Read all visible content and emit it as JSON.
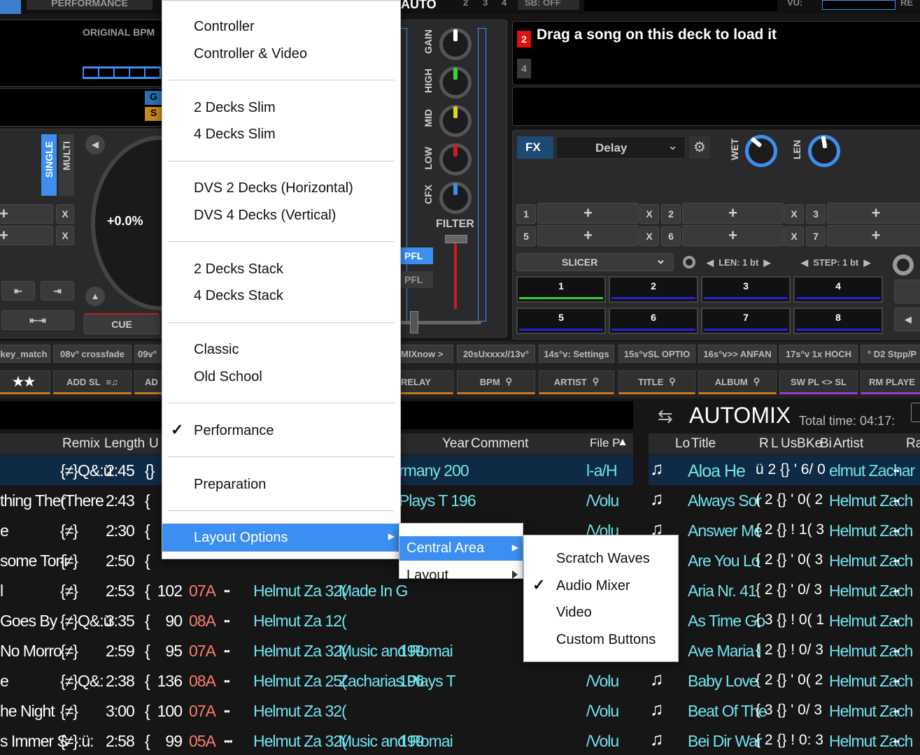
{
  "topbar": {
    "performance_tab": "PERFORMANCE",
    "auto_label": "AUTO",
    "auto_nums": [
      "2",
      "3",
      "4"
    ],
    "sb_label": "SB: OFF",
    "vu_label": "VU:",
    "re_label": "RE"
  },
  "deck_left": {
    "original_bpm": "ORIGINAL BPM",
    "g_label": "G",
    "s_label": "S",
    "single": "SINGLE",
    "multi": "MULTI",
    "pitch": "+0.0%",
    "cue": "CUE",
    "x": "X",
    "plus": "+"
  },
  "mixer": {
    "gain": "GAIN",
    "high": "HIGH",
    "mid": "MID",
    "low": "LOW",
    "cfx": "CFX",
    "filter": "FILTER",
    "pfl": "PFL",
    "pfl2": "PFL"
  },
  "deck_right": {
    "deck_num_active": "2",
    "deck_num_other": "4",
    "load_msg": "Drag a song on this deck to load it",
    "fx": "FX",
    "fx_effect": "Delay",
    "wet": "WET",
    "len": "LEN",
    "slots": [
      "1",
      "2",
      "3",
      "5",
      "6",
      "7"
    ],
    "slicer": "SLICER",
    "slicer_len": "LEN: 1 bt",
    "slicer_step": "STEP: 1 bt",
    "pads": [
      "1",
      "2",
      "3",
      "4",
      "5",
      "6",
      "7",
      "8"
    ]
  },
  "custom_buttons": [
    "key_match",
    "08v° crossfade",
    "09v°",
    "MIXnow >",
    "20sUxxxx//13v°",
    "14s°v: Settings",
    "15s°vSL OPTIO",
    "16s°v>> ANFAN",
    "17s°v 1x HOCH",
    "° D2 Stpp/P"
  ],
  "sort_buttons": {
    "stars": "★★",
    "add_sl": "ADD SL",
    "ad": "AD",
    "relay": "RELAY",
    "bpm": "BPM",
    "artist": "ARTIST",
    "title": "TITLE",
    "album": "ALBUM",
    "sw_pl": "SW PL <> SL",
    "rm_player": "RM PLAYE"
  },
  "browser": {
    "columns": [
      "Remix",
      "Length",
      "U",
      "Year",
      "Comment",
      "File P"
    ],
    "rows": [
      {
        "title": "",
        "remix": "{≠}Q&:ü",
        "length": "2:45",
        "u": "{}",
        "bpm": "",
        "key": "",
        "stars": "",
        "artist": "",
        "year": "rmany 200",
        "comment": "",
        "file": "l-a/H"
      },
      {
        "title": "thing Ther",
        "remix": "(There",
        "length": "2:43",
        "u": "{",
        "bpm": "",
        "key": "",
        "stars": "",
        "artist": "",
        "year": "Plays T 196",
        "comment": "",
        "file": "/Volu"
      },
      {
        "title": "e",
        "remix": "{≠}",
        "length": "2:30",
        "u": "{",
        "bpm": "",
        "key": "",
        "stars": "",
        "artist": "",
        "year": "",
        "comment": "",
        "file": "/Volu"
      },
      {
        "title": "some Toni",
        "remix": "{≠}",
        "length": "2:50",
        "u": "{",
        "bpm": "",
        "key": "",
        "stars": "",
        "artist": "",
        "year": "",
        "comment": "",
        "file": ""
      },
      {
        "title": "l",
        "remix": "{≠}",
        "length": "2:53",
        "u": "{",
        "bpm": "102",
        "key": "07A",
        "stars": "••",
        "artist": "Helmut Za 32(",
        "comment": "Made In G",
        "year": "",
        "file": ""
      },
      {
        "title": "Goes By",
        "remix": "{≠}Q&:ü",
        "length": "3:35",
        "u": "{",
        "bpm": "90",
        "key": "08A",
        "stars": "••",
        "artist": "Helmut Za 12(",
        "comment": "",
        "year": "",
        "file": ""
      },
      {
        "title": "No Morro",
        "remix": "{≠}",
        "length": "2:59",
        "u": "{",
        "bpm": "95",
        "key": "07A",
        "stars": "••",
        "artist": "Helmut Za 32(",
        "comment": "Music and Romai",
        "year": "199",
        "file": ""
      },
      {
        "title": "e",
        "remix": "{≠}Q&:",
        "length": "2:38",
        "u": "{",
        "bpm": "136",
        "key": "08A",
        "stars": "••",
        "artist": "Helmut Za 25(",
        "comment": "Zacharias Plays T",
        "year": "196",
        "file": "/Volu"
      },
      {
        "title": "he Night",
        "remix": "{≠}",
        "length": "3:00",
        "u": "{",
        "bpm": "100",
        "key": "07A",
        "stars": "••",
        "artist": "Helmut Za 32(",
        "comment": "",
        "year": "",
        "file": "/Volu"
      },
      {
        "title": "s Immer S",
        "remix": "{≠}:ü:",
        "length": "2:58",
        "u": "{",
        "bpm": "99",
        "key": "05A",
        "stars": "•••",
        "artist": "Helmut Za 32(",
        "comment": "Music and Romai",
        "year": "199",
        "file": "/Volu"
      }
    ]
  },
  "automix": {
    "title": "AUTOMIX",
    "total_time": "Total time: 04:17:",
    "columns": [
      "Lo",
      "Title",
      "R",
      "L",
      "Us",
      "B",
      "Ke",
      "Bi",
      "Artist",
      "Ra"
    ],
    "rows": [
      {
        "title": "Aloa He",
        "mid": "ü 2 {} ' 6/ 0",
        "artist": "elmut Zachar",
        "rating": "••"
      },
      {
        "title": "Always Sor",
        "mid": "( 2 {} ' 0( 2",
        "artist": "Helmut Zach",
        "rating": "••"
      },
      {
        "title": "Answer Me",
        "mid": "{ 2 {} ! 1( 3",
        "artist": "Helmut Zach",
        "rating": "••"
      },
      {
        "title": "Are You Lo",
        "mid": "{ 2 {} ' 0( 3",
        "artist": "Helmut Zach",
        "rating": "••"
      },
      {
        "title": "Aria Nr. 41",
        "mid": "{ 2 {} ' 0/ 3",
        "artist": "Helmut Zach",
        "rating": "••"
      },
      {
        "title": "As Time Go",
        "mid": "{ 3 {} ! 0( 1",
        "artist": "Helmut Zach",
        "rating": "••"
      },
      {
        "title": "Ave Maria I",
        "mid": "{ 2 {} ! 0/ 3",
        "artist": "Helmut Zach",
        "rating": "••"
      },
      {
        "title": "Baby Love",
        "mid": "{ 2 {} ' 0( 2",
        "artist": "Helmut Zach",
        "rating": "••"
      },
      {
        "title": "Beat Of The",
        "mid": "{ 3 {} ' 0/ 3",
        "artist": "Helmut Zach",
        "rating": "••"
      },
      {
        "title": "Bei Dir War",
        "mid": "{ 2 {} ! 0: 3",
        "artist": "Helmut Zach",
        "rating": "••"
      }
    ]
  },
  "menu": {
    "items": [
      "Controller",
      "Controller & Video",
      "2 Decks Slim",
      "4 Decks Slim",
      "DVS 2 Decks (Horizontal)",
      "DVS 4 Decks (Vertical)",
      "2 Decks Stack",
      "4 Decks Stack",
      "Classic",
      "Old School",
      "Performance",
      "Preparation",
      "Layout Options"
    ],
    "checked": "Performance"
  },
  "submenu1": {
    "items": [
      "Central Area",
      "Layout"
    ]
  },
  "submenu2": {
    "items": [
      "Scratch Waves",
      "Audio Mixer",
      "Video",
      "Custom Buttons"
    ],
    "checked": "Audio Mixer"
  },
  "colors": {
    "accent": "#3c8ff0",
    "cyan": "#6fe3ee",
    "key_red": "#ff7a6e",
    "deck_red": "#e01010"
  }
}
